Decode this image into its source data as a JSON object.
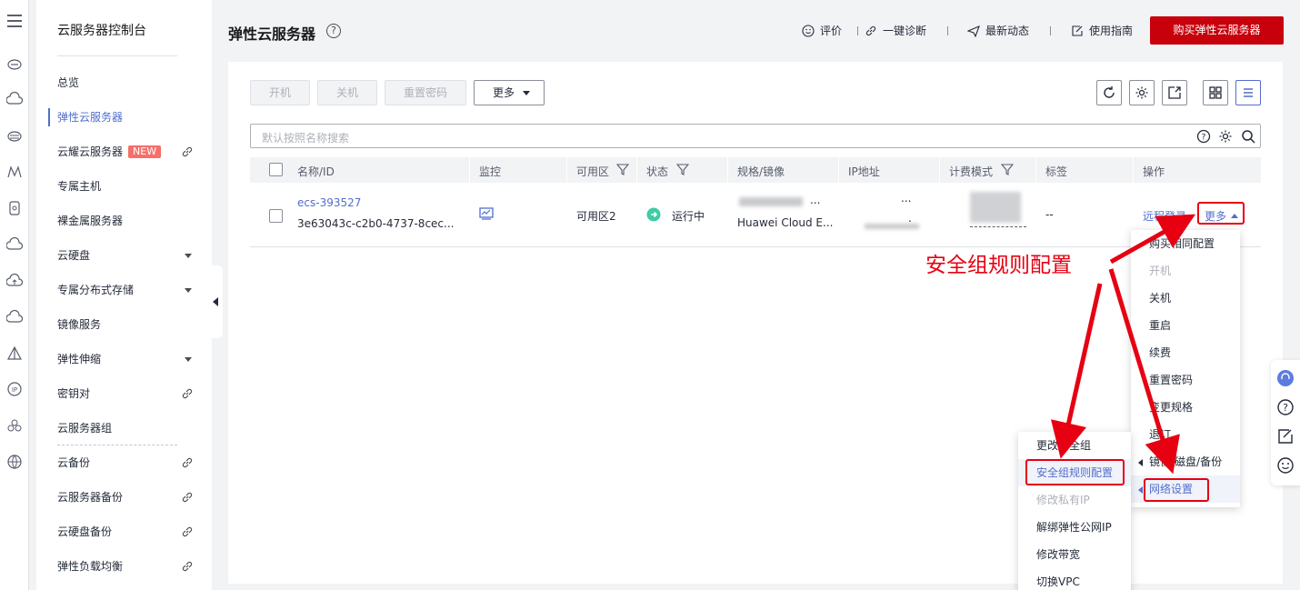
{
  "sidebar": {
    "title": "云服务器控制台",
    "items": [
      {
        "label": "总览"
      },
      {
        "label": "弹性云服务器",
        "active": true
      },
      {
        "label": "云耀云服务器",
        "badge": "NEW",
        "link": true
      },
      {
        "label": "专属主机"
      },
      {
        "label": "裸金属服务器"
      },
      {
        "label": "云硬盘",
        "expandable": true
      },
      {
        "label": "专属分布式存储",
        "expandable": true
      },
      {
        "label": "镜像服务"
      },
      {
        "label": "弹性伸缩",
        "expandable": true
      },
      {
        "label": "密钥对",
        "link": true
      },
      {
        "label": "云服务器组"
      },
      {
        "label": "云备份",
        "link": true
      },
      {
        "label": "云服务器备份",
        "link": true
      },
      {
        "label": "云硬盘备份",
        "link": true
      },
      {
        "label": "弹性负载均衡",
        "link": true
      }
    ]
  },
  "header": {
    "title": "弹性云服务器",
    "links": [
      "评价",
      "一键诊断",
      "最新动态",
      "使用指南"
    ],
    "buy_button": "购买弹性云服务器"
  },
  "toolbar": {
    "start": "开机",
    "stop": "关机",
    "reset_password": "重置密码",
    "more": "更多"
  },
  "search": {
    "placeholder": "默认按照名称搜索"
  },
  "table": {
    "columns": [
      "名称/ID",
      "监控",
      "可用区",
      "状态",
      "规格/镜像",
      "IP地址",
      "计费模式",
      "标签",
      "操作"
    ],
    "row": {
      "name": "ecs-393527",
      "id": "3e63043c-c2b0-4737-8cec...",
      "zone": "可用区2",
      "status": "运行中",
      "spec_dots": "...",
      "image": "Huawei Cloud E...",
      "ip_dots": "...",
      "ip_dot2": ".",
      "tag": "--",
      "action_remote": "远程登录",
      "action_more": "更多"
    }
  },
  "more_menu": [
    {
      "label": "购买相同配置"
    },
    {
      "label": "开机",
      "disabled": true
    },
    {
      "label": "关机"
    },
    {
      "label": "重启"
    },
    {
      "label": "续费"
    },
    {
      "label": "重置密码"
    },
    {
      "label": "变更规格"
    },
    {
      "label": "退订"
    },
    {
      "label": "镜像/磁盘/备份",
      "submenu": true
    },
    {
      "label": "网络设置",
      "submenu": true,
      "highlighted": true
    }
  ],
  "network_menu": [
    {
      "label": "更改安全组"
    },
    {
      "label": "安全组规则配置",
      "highlighted": true
    },
    {
      "label": "修改私有IP",
      "disabled": true
    },
    {
      "label": "解绑弹性公网IP"
    },
    {
      "label": "修改带宽"
    },
    {
      "label": "切换VPC"
    }
  ],
  "annotation": "安全组规则配置",
  "colors": {
    "brand_red": "#c7000b",
    "link_blue": "#526ecc",
    "annotation_red": "#e60012",
    "running_green": "#3dcca6"
  }
}
